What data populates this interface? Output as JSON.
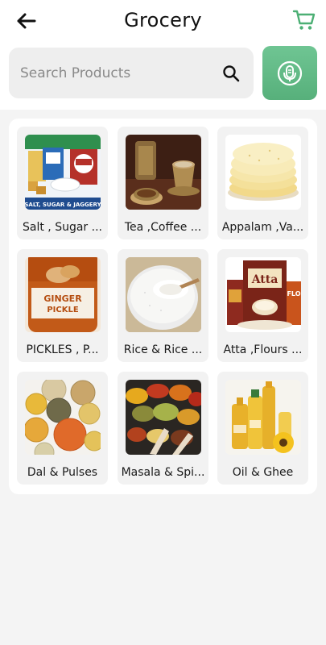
{
  "header": {
    "title": "Grocery",
    "back_icon": "arrow-left-icon",
    "cart_icon": "shopping-cart-icon",
    "accent_color": "#4caf74"
  },
  "search": {
    "placeholder": "Search Products",
    "value": "",
    "icon": "search-icon",
    "voice_icon": "microphone-icon"
  },
  "categories": [
    {
      "label": "Salt , Sugar ...",
      "image": "salt-sugar-jaggery-image",
      "banner": "SALT, SUGAR & JAGGERY"
    },
    {
      "label": "Tea  ,Coffee ...",
      "image": "tea-coffee-image"
    },
    {
      "label": "Appalam ,Va...",
      "image": "appalam-image"
    },
    {
      "label": "PICKLES , P...",
      "image": "ginger-pickle-image",
      "jar_text": "GINGER PICKLE"
    },
    {
      "label": "Rice & Rice ...",
      "image": "rice-image"
    },
    {
      "label": "Atta ,Flours ...",
      "image": "atta-flour-image",
      "pack_text": "Atta"
    },
    {
      "label": "Dal & Pulses",
      "image": "dal-pulses-image"
    },
    {
      "label": "Masala & Spi...",
      "image": "masala-spices-image"
    },
    {
      "label": "Oil & Ghee",
      "image": "oil-ghee-image"
    }
  ]
}
